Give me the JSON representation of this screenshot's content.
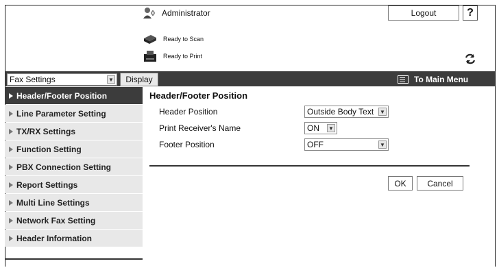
{
  "header": {
    "user": "Administrator",
    "logout_label": "Logout",
    "help_label": "?",
    "scan_status": "Ready to Scan",
    "print_status": "Ready to Print"
  },
  "toolbar": {
    "mode_select": "Fax Settings",
    "display_label": "Display",
    "main_menu_label": "To Main Menu"
  },
  "sidebar": {
    "items": [
      {
        "label": "Header/Footer Position"
      },
      {
        "label": "Line Parameter Setting"
      },
      {
        "label": "TX/RX Settings"
      },
      {
        "label": "Function Setting"
      },
      {
        "label": "PBX Connection Setting"
      },
      {
        "label": "Report Settings"
      },
      {
        "label": "Multi Line Settings"
      },
      {
        "label": "Network Fax Setting"
      },
      {
        "label": "Header Information"
      }
    ]
  },
  "main": {
    "title": "Header/Footer Position",
    "fields": [
      {
        "label": "Header Position",
        "value": "Outside Body Text"
      },
      {
        "label": "Print Receiver's Name",
        "value": "ON"
      },
      {
        "label": "Footer Position",
        "value": "OFF"
      }
    ],
    "ok_label": "OK",
    "cancel_label": "Cancel"
  },
  "icons": {
    "admin": "administrator-icon",
    "scanner": "scanner-icon",
    "printer": "printer-icon",
    "refresh": "refresh-icon",
    "main_menu": "main-menu-icon"
  }
}
